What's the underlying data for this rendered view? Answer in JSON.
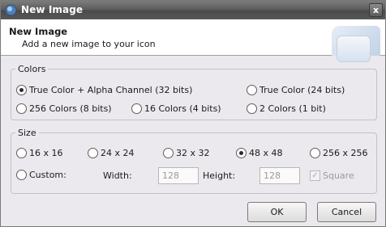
{
  "window": {
    "title": "New Image",
    "close_glyph": "x"
  },
  "header": {
    "title": "New Image",
    "subtitle": "Add a new image to your icon"
  },
  "colors": {
    "legend": "Colors",
    "options": [
      {
        "label": "True Color + Alpha Channel (32 bits)",
        "checked": true
      },
      {
        "label": "True Color (24 bits)",
        "checked": false
      },
      {
        "label": "256 Colors (8 bits)",
        "checked": false
      },
      {
        "label": "16 Colors (4 bits)",
        "checked": false
      },
      {
        "label": "2 Colors (1 bit)",
        "checked": false
      }
    ]
  },
  "size": {
    "legend": "Size",
    "options": [
      {
        "label": "16 x 16",
        "checked": false
      },
      {
        "label": "24 x 24",
        "checked": false
      },
      {
        "label": "32 x 32",
        "checked": false
      },
      {
        "label": "48 x 48",
        "checked": true
      },
      {
        "label": "256 x 256",
        "checked": false
      },
      {
        "label": "Custom:",
        "checked": false
      }
    ],
    "width_label": "Width:",
    "width_value": "128",
    "height_label": "Height:",
    "height_value": "128",
    "square_label": "Square",
    "square_checked": true
  },
  "buttons": {
    "ok": "OK",
    "cancel": "Cancel"
  }
}
